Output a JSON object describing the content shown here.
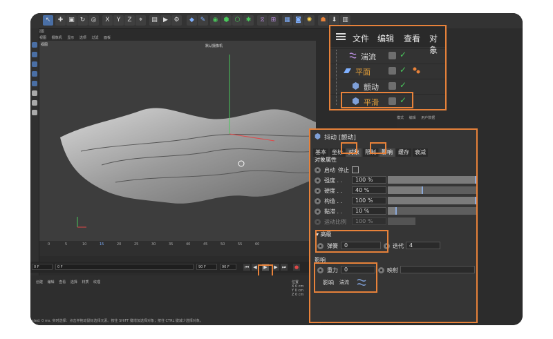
{
  "menubar_small": [
    "视图",
    "摄像机",
    "显示",
    "选项",
    "过滤",
    "面板"
  ],
  "vp_title": "视图",
  "camera_label": "默认摄像机",
  "ruler_ticks": [
    "0",
    "5",
    "10",
    "15",
    "20",
    "25",
    "30",
    "35",
    "40",
    "45",
    "50",
    "55",
    "60"
  ],
  "playbar": {
    "start": "0 F",
    "current": "0 F",
    "end": "90 F",
    "end2": "90 F"
  },
  "bottom_menu": [
    "创建",
    "编辑",
    "查看",
    "选择",
    "材质",
    "纹理"
  ],
  "coords": [
    "X  0 cm",
    "Y  0 cm",
    "Z  0 cm"
  ],
  "coords_label": "位置",
  "status": "sted: 0 ms.   实时选择：点击并拖动鼠标选择元素。按住 SHIFT 键增加选择对象；按住 CTRL 键减少选择对象。",
  "attr_dim_menu": [
    "模式",
    "编辑",
    "用户数据"
  ],
  "object_manager": {
    "menu": [
      "文件",
      "编辑",
      "查看",
      "对象"
    ],
    "rows": [
      {
        "name": "湍流",
        "color": "#dddddd"
      },
      {
        "name": "平面",
        "color": "#e8a23a"
      },
      {
        "name": "颤动",
        "color": "#dddddd"
      },
      {
        "name": "平滑",
        "color": "#e8a23a"
      }
    ],
    "check": "✓"
  },
  "attribute_manager": {
    "title": "抖动 [颤动]",
    "tabs": [
      "基本",
      "坐标",
      "对象",
      "限制",
      "影响",
      "缓存",
      "衰减"
    ],
    "section_object": "对象属性",
    "enable_label": "启动",
    "stop_label": "停止",
    "rows": [
      {
        "label": "强度 . .",
        "value": "100 %",
        "fill": 1.0
      },
      {
        "label": "硬度 . .",
        "value": "40 %",
        "fill": 0.4
      },
      {
        "label": "构造 . .",
        "value": "100 %",
        "fill": 1.0
      },
      {
        "label": "黏滞 . .",
        "value": "10 %",
        "fill": 0.1
      },
      {
        "label": "运动比例",
        "value": "100 %",
        "fill": 1.0
      }
    ],
    "advanced": "高级",
    "spring_label": "弹簧",
    "spring_value": "0",
    "iter_label": "迭代",
    "iter_value": "4",
    "section_influence": "影响",
    "gravity_label": "重力",
    "gravity_value": "0",
    "map_label": "映射",
    "influence_label": "影响",
    "influence_value": "湍流"
  }
}
